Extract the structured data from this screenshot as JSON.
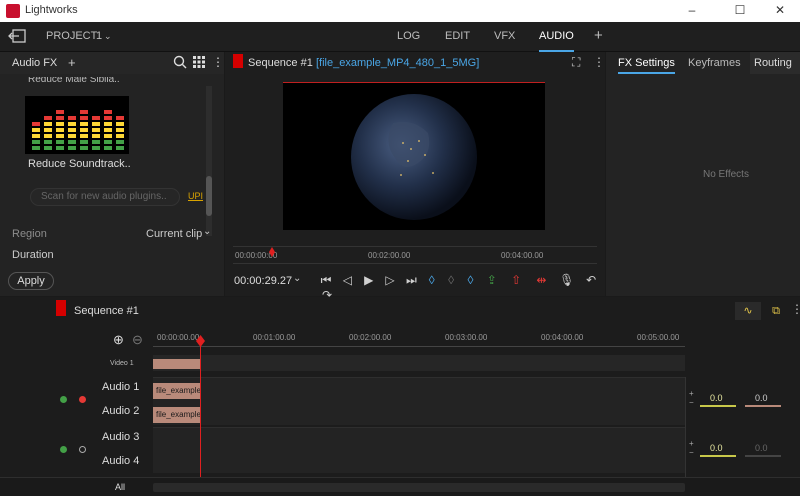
{
  "window": {
    "title": "Lightworks",
    "minimize": "–",
    "maximize": "☐",
    "close": "✕"
  },
  "menubar": {
    "back_icon": "exit-icon",
    "project_label": "PROJECT",
    "project_number": "1",
    "tabs": [
      "LOG",
      "EDIT",
      "VFX",
      "AUDIO"
    ],
    "active_tab": "AUDIO",
    "add": "+"
  },
  "audio_fx": {
    "title": "Audio FX",
    "add": "+",
    "item_top": "Reduce Male Sibila..",
    "item_main": "Reduce Soundtrack..",
    "scan_placeholder": "Scan for new audio plugins..",
    "upd": "UPI",
    "region_label": "Region",
    "region_value": "Current clip",
    "duration_label": "Duration",
    "apply": "Apply"
  },
  "viewer": {
    "sequence": "Sequence #1",
    "file": "[file_example_MP4_480_1_5MG]",
    "ruler": [
      "00:00:00:00",
      "00:02:00.00",
      "00:04:00.00"
    ],
    "timecode": "00:00:29.27"
  },
  "fx_panel": {
    "tabs": [
      "FX Settings",
      "Keyframes",
      "Routing"
    ],
    "empty": "No Effects"
  },
  "timeline": {
    "sequence": "Sequence #1",
    "ruler": [
      "00:00:00.00",
      "00:01:00.00",
      "00:02:00.00",
      "00:03:00.00",
      "00:04:00.00",
      "00:05:00.00"
    ],
    "video_track": "Video 1",
    "audio1": "Audio 1",
    "audio2": "Audio 2",
    "audio3": "Audio 3",
    "audio4": "Audio 4",
    "clip1": "file_example",
    "clip2": "file_example",
    "all": "All",
    "mix1_left": "0.0",
    "mix1_right": "0.0",
    "mix2_left": "0.0",
    "mix2_right": "0.0"
  },
  "colors": {
    "accent": "#4aa6e6",
    "flag": "#d50000",
    "clip": "#b98a7a",
    "playhead": "#e02020"
  }
}
